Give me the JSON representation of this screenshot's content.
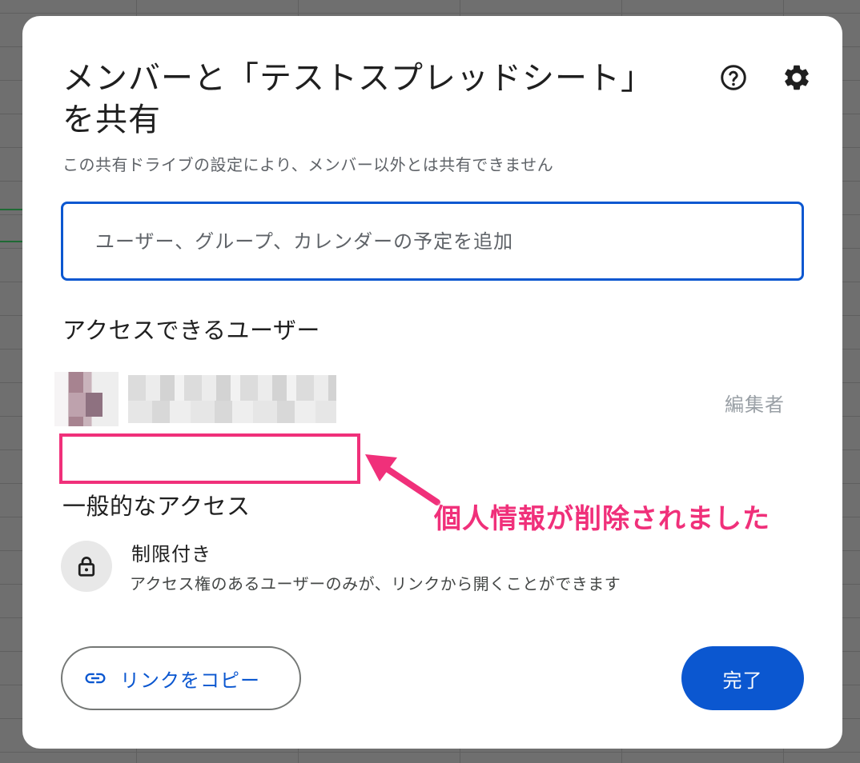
{
  "dialog": {
    "title": "メンバーと「テストスプレッドシート」を共有",
    "subtitle": "この共有ドライブの設定により、メンバー以外とは共有できません",
    "help_icon": "help-circle-icon",
    "settings_icon": "gear-icon"
  },
  "search": {
    "placeholder": "ユーザー、グループ、カレンダーの予定を追加",
    "value": ""
  },
  "people_with_access": {
    "heading": "アクセスできるユーザー",
    "users": [
      {
        "role": "編集者"
      }
    ]
  },
  "annotation": {
    "text": "個人情報が削除されました",
    "color": "#f0307a"
  },
  "general_access": {
    "heading": "一般的なアクセス",
    "icon": "lock-icon",
    "level": "制限付き",
    "description": "アクセス権のあるユーザーのみが、リンクから開くことができます"
  },
  "footer": {
    "copy_link_label": "リンクをコピー",
    "copy_link_icon": "link-icon",
    "done_label": "完了"
  },
  "colors": {
    "accent": "#0b57d0",
    "annotation": "#f0307a"
  }
}
